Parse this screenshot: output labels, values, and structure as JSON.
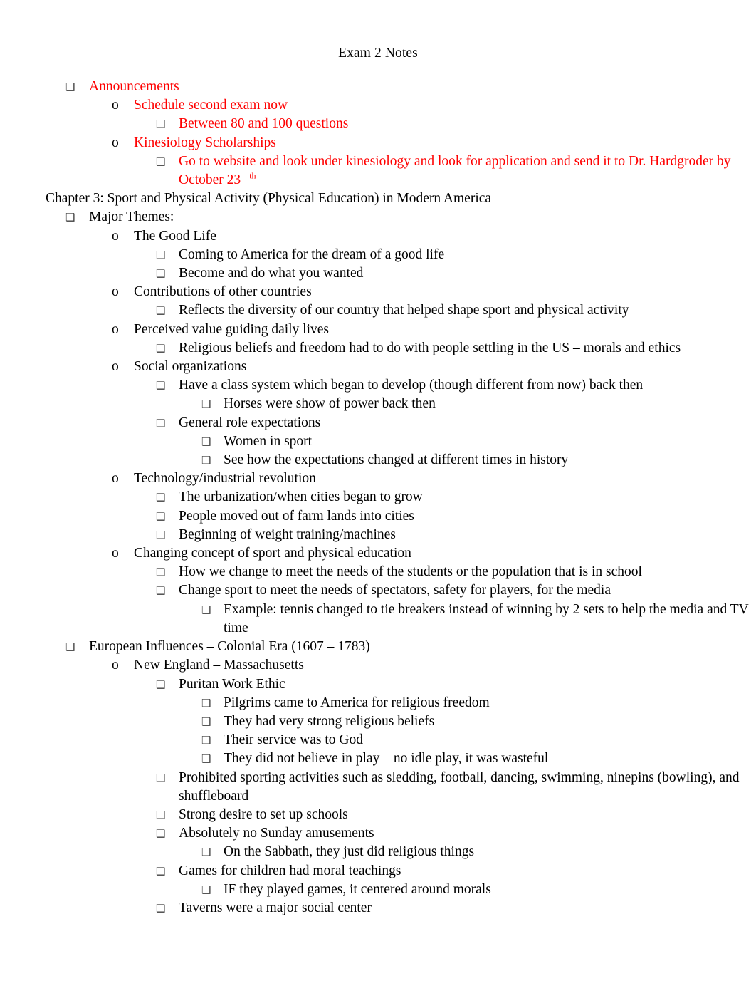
{
  "document": {
    "title": "Exam 2 Notes",
    "text_colors": {
      "default": "#000000",
      "highlight": "#ff0000",
      "bullet_marker": "#3f3f3f"
    },
    "bullet_glyphs": {
      "level1": "❑",
      "level2": "o",
      "level3": "❑",
      "level4": "❑"
    },
    "outline": [
      {
        "level": 1,
        "marker": "box",
        "color": "red",
        "text": "Announcements"
      },
      {
        "level": 2,
        "marker": "circle",
        "color": "red",
        "text": "Schedule second exam now"
      },
      {
        "level": 3,
        "marker": "box",
        "color": "red",
        "text": "Between 80 and 100 questions"
      },
      {
        "level": 2,
        "marker": "circle",
        "color": "red",
        "text": "Kinesiology Scholarships"
      },
      {
        "level": 3,
        "marker": "box",
        "color": "red",
        "text": "Go to website and look under kinesiology and look for application and send it to Dr. Hardgroder by October 23",
        "superscript": "th"
      },
      {
        "level": 0,
        "marker": "none",
        "color": "black",
        "text": "Chapter 3: Sport and Physical Activity (Physical Education) in Modern America"
      },
      {
        "level": 1,
        "marker": "box",
        "color": "black",
        "text": "Major Themes:"
      },
      {
        "level": 2,
        "marker": "circle",
        "color": "black",
        "text": "The Good Life"
      },
      {
        "level": 3,
        "marker": "box",
        "color": "black",
        "text": "Coming to America for the dream of a good life"
      },
      {
        "level": 3,
        "marker": "box",
        "color": "black",
        "text": "Become and do what you wanted"
      },
      {
        "level": 2,
        "marker": "circle",
        "color": "black",
        "text": "Contributions of other countries"
      },
      {
        "level": 3,
        "marker": "box",
        "color": "black",
        "text": "Reflects the diversity of our country that helped shape sport and physical activity"
      },
      {
        "level": 2,
        "marker": "circle",
        "color": "black",
        "text": "Perceived value guiding daily lives"
      },
      {
        "level": 3,
        "marker": "box",
        "color": "black",
        "text": "Religious beliefs and freedom had to do with people settling in the US – morals and ethics"
      },
      {
        "level": 2,
        "marker": "circle",
        "color": "black",
        "text": "Social organizations"
      },
      {
        "level": 3,
        "marker": "box",
        "color": "black",
        "text": "Have a class system which began to develop (though different from now) back then"
      },
      {
        "level": 4,
        "marker": "box",
        "color": "black",
        "text": "Horses were show of power back then"
      },
      {
        "level": 3,
        "marker": "box",
        "color": "black",
        "text": "General role expectations"
      },
      {
        "level": 4,
        "marker": "box",
        "color": "black",
        "text": "Women in sport"
      },
      {
        "level": 4,
        "marker": "box",
        "color": "black",
        "text": "See how the expectations changed at different times in history"
      },
      {
        "level": 2,
        "marker": "circle",
        "color": "black",
        "text": "Technology/industrial revolution"
      },
      {
        "level": 3,
        "marker": "box",
        "color": "black",
        "text": "The urbanization/when cities began to grow"
      },
      {
        "level": 3,
        "marker": "box",
        "color": "black",
        "text": "People moved out of farm lands into cities"
      },
      {
        "level": 3,
        "marker": "box",
        "color": "black",
        "text": "Beginning of weight training/machines"
      },
      {
        "level": 2,
        "marker": "circle",
        "color": "black",
        "text": "Changing concept of sport and physical education"
      },
      {
        "level": 3,
        "marker": "box",
        "color": "black",
        "text": "How we change to meet the needs of the students or the population that is in school"
      },
      {
        "level": 3,
        "marker": "box",
        "color": "black",
        "text": "Change sport to meet the needs of spectators, safety for players, for the media"
      },
      {
        "level": 4,
        "marker": "box",
        "color": "black",
        "text": "Example: tennis changed to tie breakers instead of winning by 2 sets to help the media and TV time"
      },
      {
        "level": 1,
        "marker": "box",
        "color": "black",
        "text": "European Influences – Colonial Era (1607 – 1783)"
      },
      {
        "level": 2,
        "marker": "circle",
        "color": "black",
        "text": "New England – Massachusetts"
      },
      {
        "level": 3,
        "marker": "box",
        "color": "black",
        "text": "Puritan Work Ethic"
      },
      {
        "level": 4,
        "marker": "box",
        "color": "black",
        "text": "Pilgrims came to America for religious freedom"
      },
      {
        "level": 4,
        "marker": "box",
        "color": "black",
        "text": "They had very strong religious beliefs"
      },
      {
        "level": 4,
        "marker": "box",
        "color": "black",
        "text": "Their service was to God"
      },
      {
        "level": 4,
        "marker": "box",
        "color": "black",
        "text": "They did not believe in play – no idle play, it was wasteful"
      },
      {
        "level": 3,
        "marker": "box",
        "color": "black",
        "text": "Prohibited sporting activities such as sledding, football, dancing, swimming, ninepins (bowling), and shuffleboard"
      },
      {
        "level": 3,
        "marker": "box",
        "color": "black",
        "text": "Strong desire to set up schools"
      },
      {
        "level": 3,
        "marker": "box",
        "color": "black",
        "text": "Absolutely no Sunday amusements"
      },
      {
        "level": 4,
        "marker": "box",
        "color": "black",
        "text": "On the Sabbath, they just did religious things"
      },
      {
        "level": 3,
        "marker": "box",
        "color": "black",
        "text": "Games for children had moral teachings"
      },
      {
        "level": 4,
        "marker": "box",
        "color": "black",
        "text": "IF they played games, it centered around morals"
      },
      {
        "level": 3,
        "marker": "box",
        "color": "black",
        "text": "Taverns were a major social center"
      }
    ]
  }
}
